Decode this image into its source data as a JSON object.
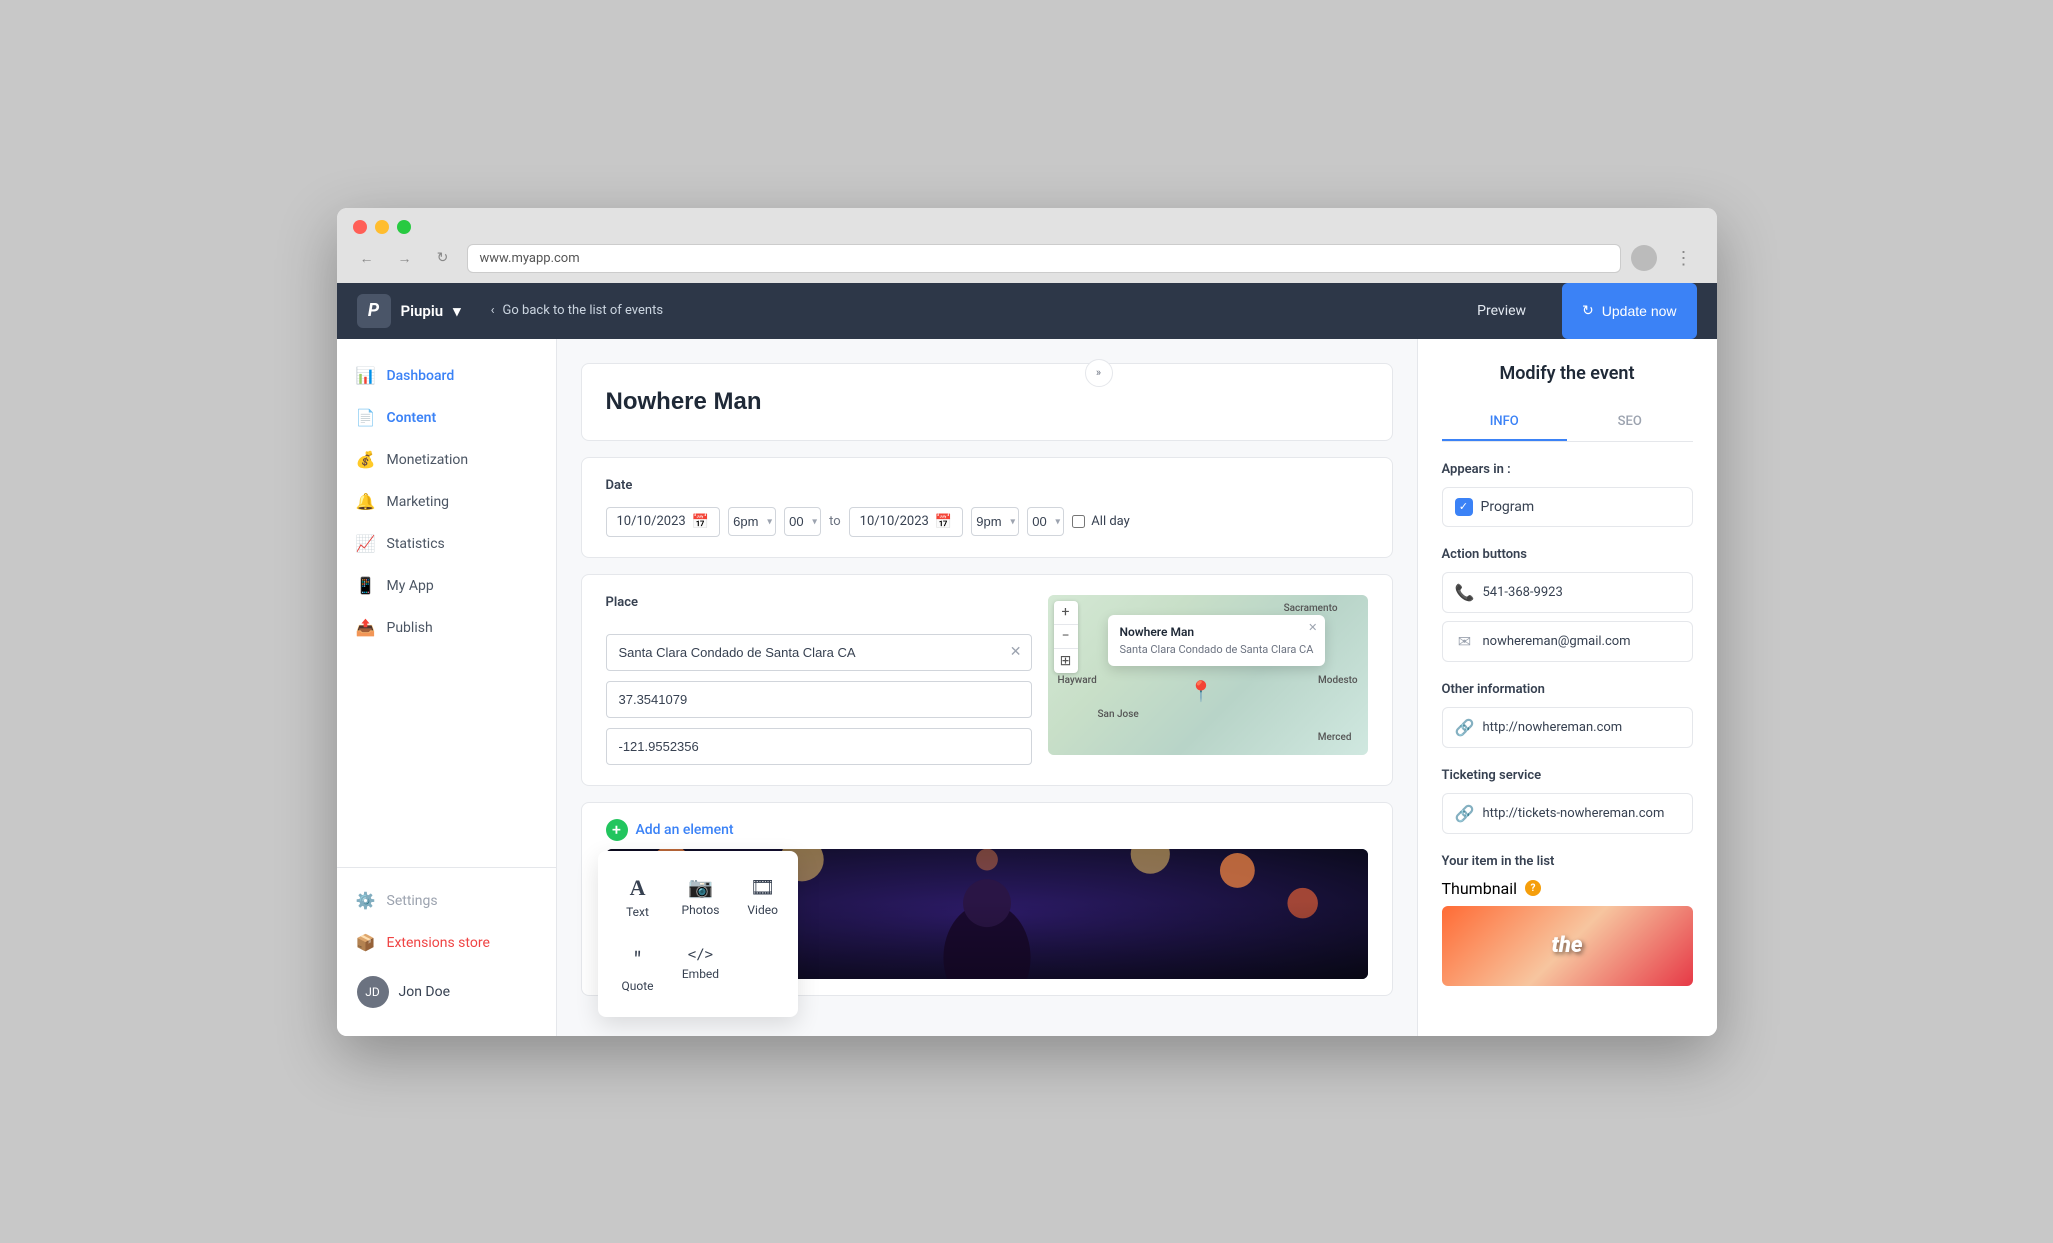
{
  "browser": {
    "url": "www.myapp.com",
    "back_label": "←",
    "forward_label": "→",
    "refresh_label": "↻"
  },
  "topnav": {
    "logo_initial": "P",
    "app_name": "Piupiu",
    "dropdown_indicator": "▾",
    "back_label": "‹  Go back to the list of events",
    "preview_label": "Preview",
    "update_label": "Update now",
    "update_icon": "↻"
  },
  "sidebar": {
    "items": [
      {
        "id": "dashboard",
        "label": "Dashboard",
        "icon": "📊"
      },
      {
        "id": "content",
        "label": "Content",
        "icon": "📄",
        "active": true
      },
      {
        "id": "monetization",
        "label": "Monetization",
        "icon": "💰"
      },
      {
        "id": "marketing",
        "label": "Marketing",
        "icon": "🔔"
      },
      {
        "id": "statistics",
        "label": "Statistics",
        "icon": "📈"
      },
      {
        "id": "myapp",
        "label": "My App",
        "icon": "📱"
      },
      {
        "id": "publish",
        "label": "Publish",
        "icon": "📤"
      }
    ],
    "bottom": [
      {
        "id": "settings",
        "label": "Settings",
        "icon": "⚙️",
        "style": "muted"
      },
      {
        "id": "extensions",
        "label": "Extensions store",
        "icon": "🔴",
        "style": "red"
      }
    ],
    "user": {
      "name": "Jon Doe",
      "initials": "JD"
    }
  },
  "event": {
    "title": "Nowhere Man",
    "date_section_label": "Date",
    "date_from": "10/10/2023",
    "time_from": "6pm",
    "minutes_from": "00",
    "to_label": "to",
    "date_to": "10/10/2023",
    "time_to": "9pm",
    "minutes_to": "00",
    "all_day_label": "All day",
    "place_section_label": "Place",
    "place_name": "Santa Clara Condado de Santa Clara CA",
    "lat": "37.3541079",
    "lng": "-121.9552356",
    "map_popup_title": "Nowhere Man",
    "map_popup_addr": "Santa Clara Condado de Santa Clara CA",
    "map_labels": [
      "Sacramento",
      "Modesto",
      "Merced",
      "San Jose",
      "Hayward"
    ],
    "add_element_label": "Add an element"
  },
  "elements_popup": {
    "visible": true,
    "items": [
      {
        "id": "text",
        "label": "Text",
        "icon": "A"
      },
      {
        "id": "photos",
        "label": "Photos",
        "icon": "📷"
      },
      {
        "id": "video",
        "label": "Video",
        "icon": "🎬"
      },
      {
        "id": "quote",
        "label": "Quote",
        "icon": "❝"
      },
      {
        "id": "embed",
        "label": "Embed",
        "icon": "</>"
      }
    ]
  },
  "right_panel": {
    "title": "Modify the event",
    "tab_info": "INFO",
    "tab_seo": "SEO",
    "appears_in_label": "Appears in :",
    "program_label": "Program",
    "action_buttons_label": "Action buttons",
    "phone": "541-368-9923",
    "email": "nowhereman@gmail.com",
    "other_info_label": "Other information",
    "website": "http://nowhereman.com",
    "ticketing_label": "Ticketing service",
    "ticketing_url": "http://tickets-nowhereman.com",
    "list_item_label": "Your item in the list",
    "thumbnail_label": "Thumbnail",
    "thumbnail_text": "the"
  }
}
